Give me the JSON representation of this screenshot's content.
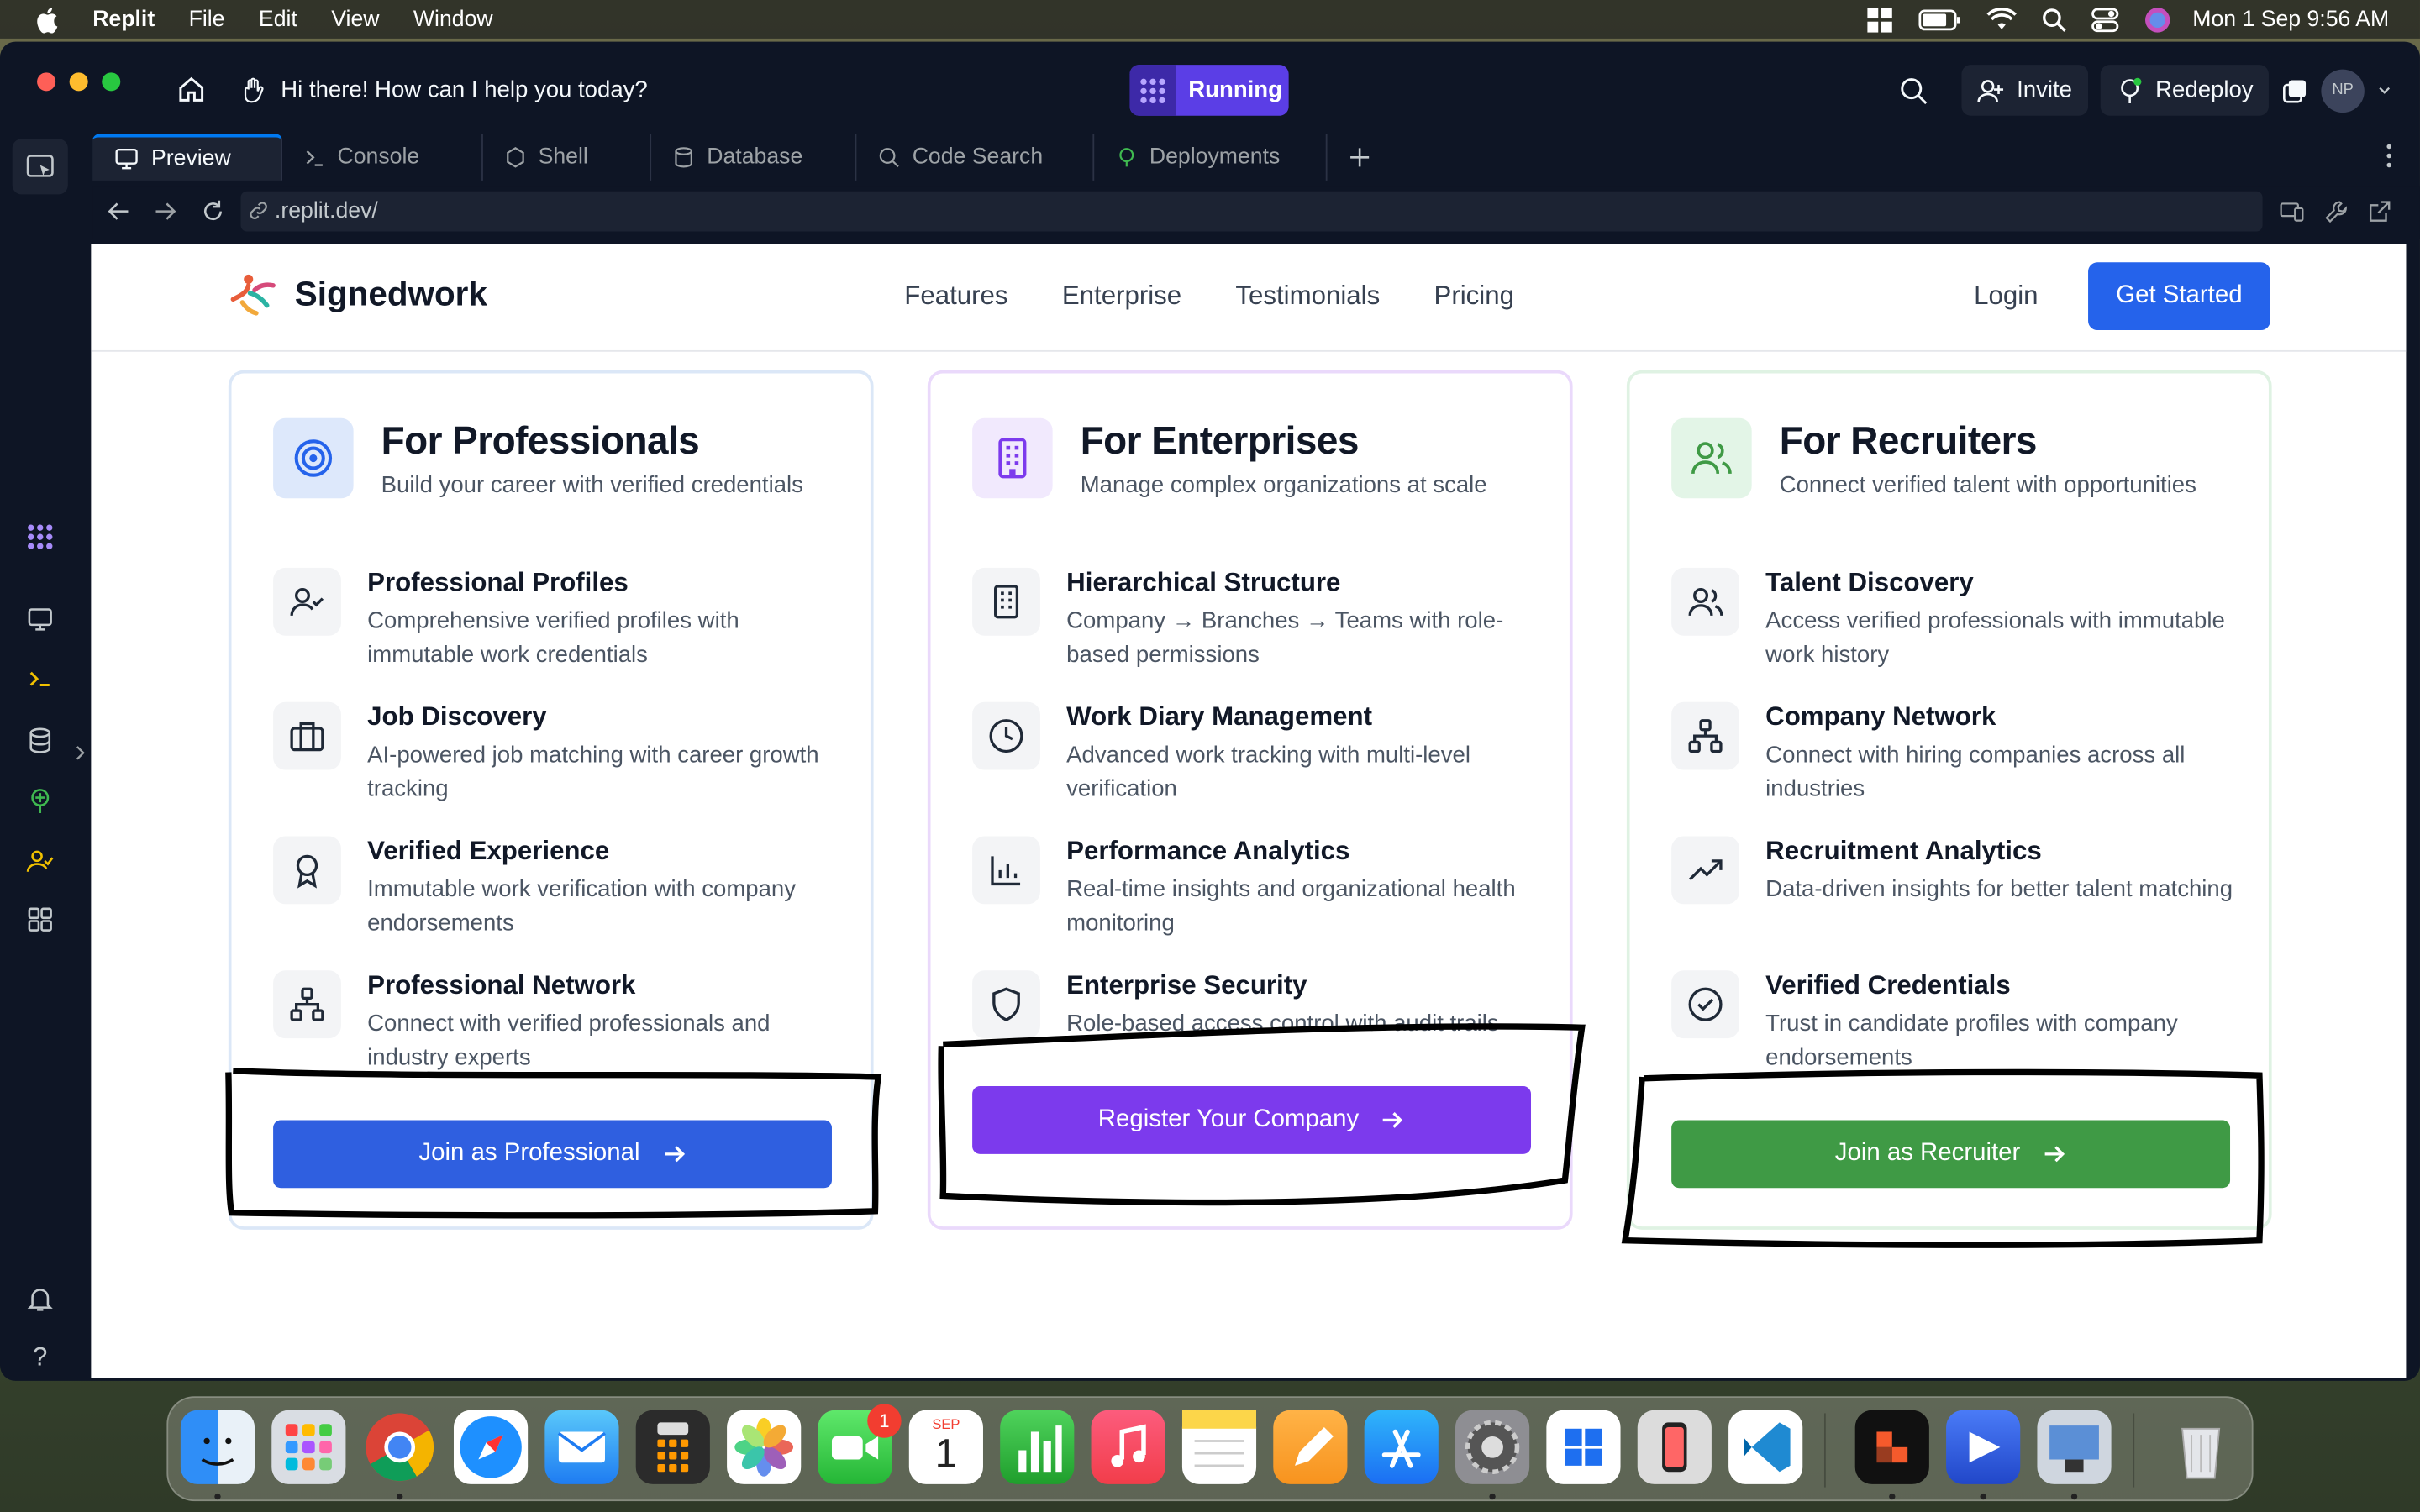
{
  "menubar": {
    "app": "Replit",
    "items": [
      "File",
      "Edit",
      "View",
      "Window"
    ],
    "clock": "Mon 1 Sep  9:56 AM"
  },
  "titlebar": {
    "prompt": "Hi there! How can I help you today?",
    "status": "Running",
    "invite": "Invite",
    "redeploy": "Redeploy",
    "avatar": "NP"
  },
  "tabs": [
    {
      "label": "Preview",
      "icon": "monitor-icon"
    },
    {
      "label": "Console",
      "icon": "terminal-icon"
    },
    {
      "label": "Shell",
      "icon": "shell-icon"
    },
    {
      "label": "Database",
      "icon": "database-icon"
    },
    {
      "label": "Code Search",
      "icon": "search-icon"
    },
    {
      "label": "Deployments",
      "icon": "deploy-icon"
    }
  ],
  "address": {
    "url": ".replit.dev/"
  },
  "site": {
    "brand": "Signedwork",
    "nav": [
      "Features",
      "Enterprise",
      "Testimonials",
      "Pricing"
    ],
    "login": "Login",
    "get_started": "Get Started",
    "cards": [
      {
        "title": "For Professionals",
        "subtitle": "Build your career with verified credentials",
        "accent": "#2563eb",
        "tint": "#e8f0fe",
        "cta": "Join as Professional",
        "features": [
          {
            "title": "Professional Profiles",
            "desc": "Comprehensive verified profiles with immutable work credentials",
            "icon": "user-check-icon"
          },
          {
            "title": "Job Discovery",
            "desc": "AI-powered job matching with career growth tracking",
            "icon": "briefcase-icon"
          },
          {
            "title": "Verified Experience",
            "desc": "Immutable work verification with company endorsements",
            "icon": "award-icon"
          },
          {
            "title": "Professional Network",
            "desc": "Connect with verified professionals and industry experts",
            "icon": "network-icon"
          }
        ]
      },
      {
        "title": "For Enterprises",
        "subtitle": "Manage complex organizations at scale",
        "accent": "#7c3aed",
        "tint": "#f1ebfe",
        "cta": "Register Your Company",
        "features": [
          {
            "title": "Hierarchical Structure",
            "desc": "Company → Branches → Teams with role-based permissions",
            "icon": "building-icon"
          },
          {
            "title": "Work Diary Management",
            "desc": "Advanced work tracking with multi-level verification",
            "icon": "clock-icon"
          },
          {
            "title": "Performance Analytics",
            "desc": "Real-time insights and organizational health monitoring",
            "icon": "bar-chart-icon"
          },
          {
            "title": "Enterprise Security",
            "desc": "Role-based access control with audit trails",
            "icon": "shield-icon"
          }
        ]
      },
      {
        "title": "For Recruiters",
        "subtitle": "Connect verified talent with opportunities",
        "accent": "#3f9a45",
        "tint": "#e7f6ea",
        "cta": "Join as Recruiter",
        "features": [
          {
            "title": "Talent Discovery",
            "desc": "Access verified professionals with immutable work history",
            "icon": "users-icon"
          },
          {
            "title": "Company Network",
            "desc": "Connect with hiring companies across all industries",
            "icon": "network-icon"
          },
          {
            "title": "Recruitment Analytics",
            "desc": "Data-driven insights for better talent matching",
            "icon": "trending-up-icon"
          },
          {
            "title": "Verified Credentials",
            "desc": "Trust in candidate profiles with company endorsements",
            "icon": "check-circle-icon"
          }
        ]
      }
    ]
  },
  "dock": {
    "apps": [
      "Finder",
      "Launchpad",
      "Chrome",
      "Safari",
      "Mail",
      "Calculator",
      "Photos",
      "FaceTime",
      "Calendar",
      "Numbers",
      "Music",
      "Notes",
      "Pages",
      "App Store",
      "System Settings",
      "Windows App",
      "iPhone Mirroring",
      "VS Code",
      "App",
      "App",
      "Preview",
      "Trash"
    ],
    "facetime_badge": "1",
    "calendar_month": "SEP",
    "calendar_day": "1"
  }
}
